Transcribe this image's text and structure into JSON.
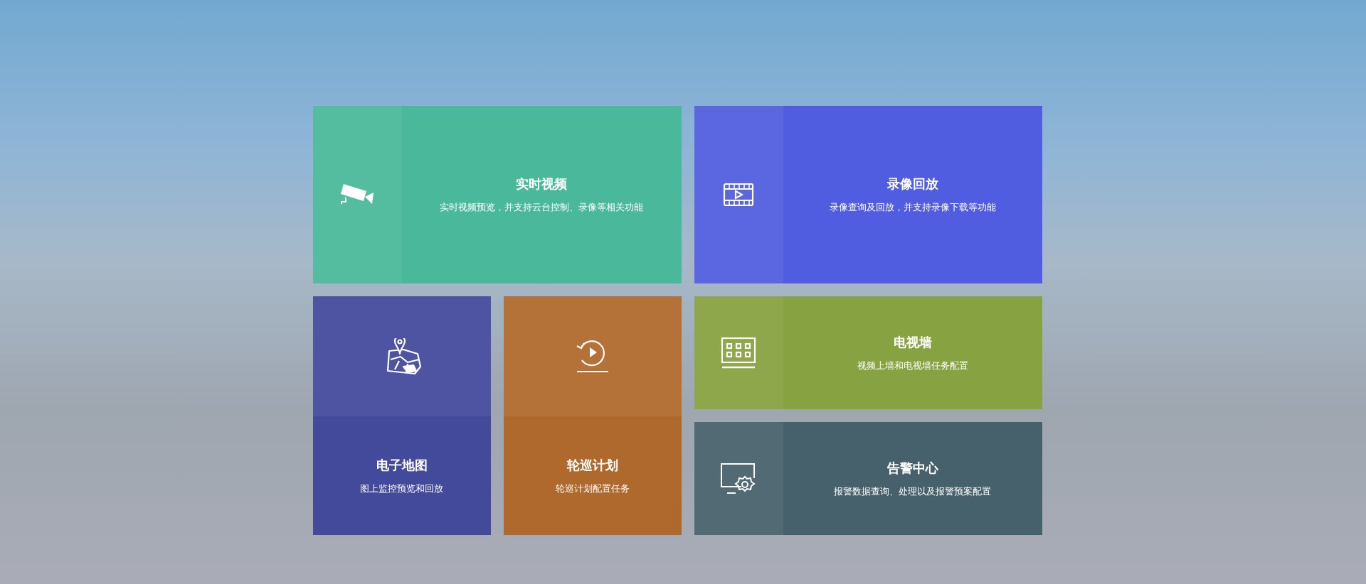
{
  "tiles": [
    {
      "kind": "wide",
      "title": "实时视频",
      "description": "实时视频预览，并支持云台控制、录像等相关功能",
      "color": "#4ab89a"
    },
    {
      "kind": "wide",
      "title": "录像回放",
      "description": "录像查询及回放，并支持录像下载等功能",
      "color": "#515de0"
    },
    {
      "kind": "tall",
      "title": "电子地图",
      "description": "图上监控预览和回放",
      "color": "#434a9c"
    },
    {
      "kind": "tall",
      "title": "轮巡计划",
      "description": "轮巡计划配置任务",
      "color": "#b0692c"
    },
    {
      "kind": "wide",
      "title": "电视墙",
      "description": "视频上墙和电视墙任务配置",
      "color": "#87a240"
    },
    {
      "kind": "wide",
      "title": "告警中心",
      "description": "报警数据查询、处理以及报警预案配置",
      "color": "#47616c"
    }
  ]
}
